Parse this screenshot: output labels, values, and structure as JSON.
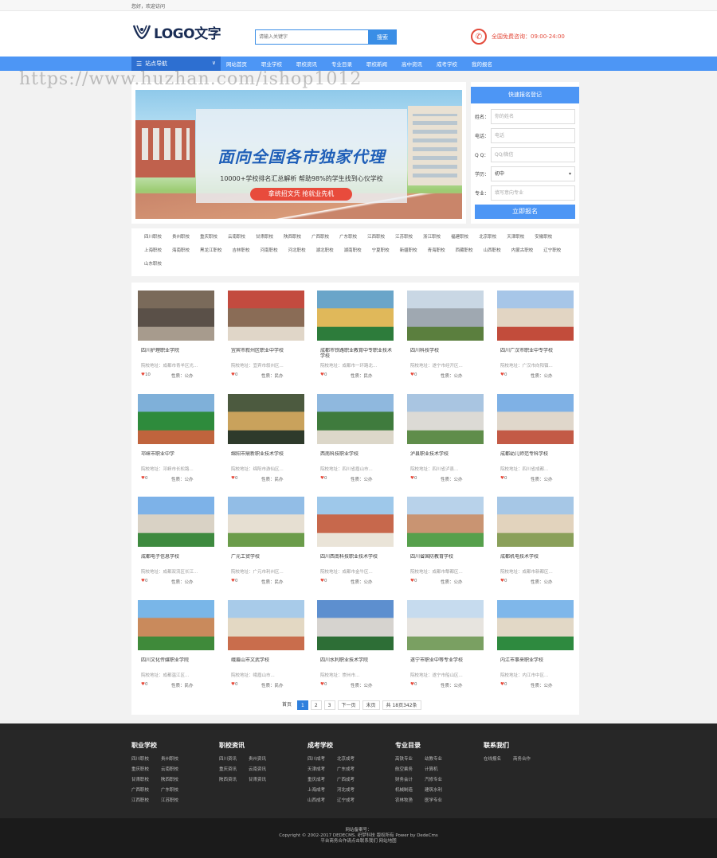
{
  "topbar": {
    "greeting": "您好，欢迎访问"
  },
  "header": {
    "logo_text": "LOGO文字",
    "search_placeholder": "请输入关键字",
    "search_button": "搜索",
    "hotline": "全国免费咨询：09:00-24:00"
  },
  "nav": {
    "category_label": "站点导航",
    "items": [
      "网站首页",
      "职业学校",
      "职校资讯",
      "专业目录",
      "职校新闻",
      "高中资讯",
      "成考学校",
      "我的报名"
    ]
  },
  "watermark": "https://www.huzhan.com/ishop1012",
  "banner": {
    "headline": "面向全国各市独家代理",
    "subline": "10000+学校排名汇总解析    帮助98%的学生找到心仪学校",
    "button": "拿统招文凭 抢就业先机"
  },
  "registration": {
    "title": "快速报名登记",
    "fields": [
      {
        "label": "姓名：",
        "placeholder": "你的姓名"
      },
      {
        "label": "电话：",
        "placeholder": "电话"
      },
      {
        "label": "Q Q：",
        "placeholder": "QQ/微信"
      },
      {
        "label": "学历：",
        "value": "初中"
      },
      {
        "label": "专业：",
        "placeholder": "填写意向专业"
      }
    ],
    "submit": "立即报名"
  },
  "tags": [
    "四川职校",
    "贵州职校",
    "重庆职校",
    "云南职校",
    "甘肃职校",
    "陕西职校",
    "广西职校",
    "广东职校",
    "江西职校",
    "江苏职校",
    "浙江职校",
    "福建职校",
    "北京职校",
    "天津职校",
    "安徽职校",
    "上海职校",
    "海南职校",
    "黑龙江职校",
    "吉林职校",
    "河南职校",
    "河北职校",
    "湖北职校",
    "湖南职校",
    "宁夏职校",
    "新疆职校",
    "青海职校",
    "西藏职校",
    "山西职校",
    "内蒙古职校",
    "辽宁职校",
    "山东职校"
  ],
  "schools": [
    {
      "name": "四川护理职业学院",
      "addr": "院校地址：成都市青羊区光...",
      "likes": "10",
      "nature": "性质：公办"
    },
    {
      "name": "宜宾市叙州区职业中学校",
      "addr": "院校地址：宜宾市叙州区...",
      "likes": "0",
      "nature": "性质：民办"
    },
    {
      "name": "成都市铁路职业教育中专职业技术学校",
      "addr": "院校地址：成都市一环路北...",
      "likes": "0",
      "nature": "性质：民办"
    },
    {
      "name": "四川科技学校",
      "addr": "院校地址：遂宁市经开区...",
      "likes": "0",
      "nature": "性质：公办"
    },
    {
      "name": "四川广汉市职业中专学校",
      "addr": "院校地址：广汉市向阳镇...",
      "likes": "0",
      "nature": "性质：公办"
    },
    {
      "name": "邛崃市职业中学",
      "addr": "院校地址：邛崃市长松路...",
      "likes": "0",
      "nature": "性质：公办"
    },
    {
      "name": "绵阳市鼎新职业技术学校",
      "addr": "院校地址：绵阳市游仙区...",
      "likes": "0",
      "nature": "性质：民办"
    },
    {
      "name": "西南科技职业学校",
      "addr": "院校地址：四川省眉山市...",
      "likes": "0",
      "nature": "性质：公办"
    },
    {
      "name": "泸县职业技术学校",
      "addr": "院校地址：四川省泸县...",
      "likes": "0",
      "nature": "性质：公办"
    },
    {
      "name": "成都幼儿师范专科学校",
      "addr": "院校地址：四川省成都...",
      "likes": "0",
      "nature": "性质：公办"
    },
    {
      "name": "成都电子信息学校",
      "addr": "院校地址：成都双流区长江...",
      "likes": "0",
      "nature": "性质：公办"
    },
    {
      "name": "广元工贸学校",
      "addr": "院校地址：广元市利州区...",
      "likes": "0",
      "nature": "性质：民办"
    },
    {
      "name": "四川西南科技职业技术学校",
      "addr": "院校地址：成都市金牛区...",
      "likes": "0",
      "nature": "性质：公办"
    },
    {
      "name": "四川省国防教育学校",
      "addr": "院校地址：成都市郫都区...",
      "likes": "0",
      "nature": "性质：公办"
    },
    {
      "name": "成都机电技术学校",
      "addr": "院校地址：成都市新都区...",
      "likes": "0",
      "nature": "性质：公办"
    },
    {
      "name": "四川文化传媒职业学院",
      "addr": "院校地址：成都温江区...",
      "likes": "0",
      "nature": "性质：民办"
    },
    {
      "name": "峨眉山市文武学校",
      "addr": "院校地址：峨眉山市...",
      "likes": "0",
      "nature": "性质：民办"
    },
    {
      "name": "四川水利职业技术学院",
      "addr": "院校地址：崇州市...",
      "likes": "0",
      "nature": "性质：公办"
    },
    {
      "name": "遂宁市职业中等专业学校",
      "addr": "院校地址：遂宁市船山区...",
      "likes": "0",
      "nature": "性质：公办"
    },
    {
      "name": "内江市事来职业学校",
      "addr": "院校地址：内江市中区...",
      "likes": "0",
      "nature": "性质：公办"
    }
  ],
  "pager": {
    "first": "首页",
    "pages": [
      "1",
      "2",
      "3"
    ],
    "next": "下一页",
    "last": "末页",
    "summary": "共 18页342条"
  },
  "footer": {
    "columns": [
      {
        "title": "职业学校",
        "links": [
          "四川职校",
          "贵州职校",
          "重庆职校",
          "云南职校",
          "甘肃职校",
          "陕西职校",
          "广西职校",
          "广东职校",
          "江西职校",
          "江苏职校"
        ]
      },
      {
        "title": "职校资讯",
        "links": [
          "四川资讯",
          "贵州资讯",
          "重庆资讯",
          "云南资讯",
          "陕西资讯",
          "甘肃资讯"
        ]
      },
      {
        "title": "成考学校",
        "links": [
          "四川成考",
          "北京成考",
          "天津成考",
          "广东成考",
          "重庆成考",
          "广西成考",
          "上海成考",
          "河北成考",
          "山西成考",
          "辽宁成考"
        ]
      },
      {
        "title": "专业目录",
        "links": [
          "高铁专业",
          "幼教专业",
          "航空乘务",
          "计算机",
          "财务会计",
          "汽修专业",
          "机械制造",
          "建筑水利",
          "农林牧渔",
          "医学专业"
        ]
      },
      {
        "title": "联系我们",
        "links": [
          "在线报名",
          "商务合作"
        ]
      }
    ],
    "icp": "网站备案号：",
    "copyright": "Copyright © 2002-2017 DEDECMS. 织梦科技 版权所有    Power by DedeCms",
    "links": "平台商务合作请点击联系我们    网站地图"
  }
}
